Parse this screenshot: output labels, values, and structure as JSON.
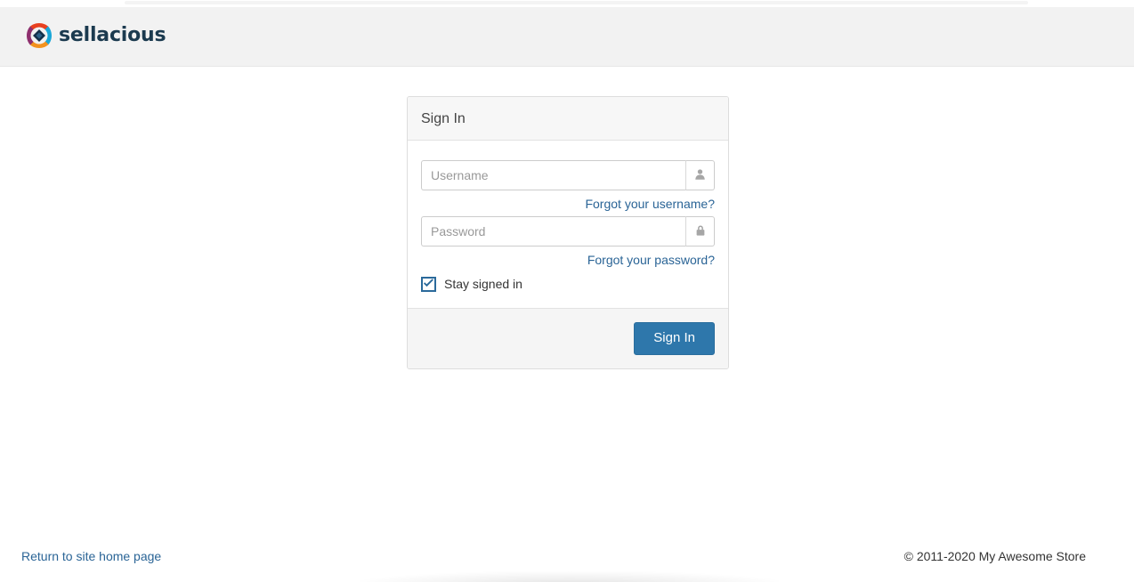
{
  "header": {
    "brand_name": "sellacious",
    "logo_icon": "sellacious-diamond-logo",
    "logo_colors": {
      "top_petal": "#e8401f",
      "right_petal": "#1aa7d8",
      "bottom_petal": "#f3921e",
      "left_petal": "#8e2f6e",
      "center_diamond": "#14304a"
    },
    "background": "#f2f2f2"
  },
  "login": {
    "card_title": "Sign In",
    "username": {
      "placeholder": "Username",
      "value": "",
      "icon": "user-icon",
      "forgot_link": "Forgot your username?"
    },
    "password": {
      "placeholder": "Password",
      "value": "",
      "icon": "lock-icon",
      "forgot_link": "Forgot your password?"
    },
    "remember": {
      "label": "Stay signed in",
      "checked": true
    },
    "submit_label": "Sign In",
    "accent_color": "#2e77ab",
    "link_color": "#2a6496"
  },
  "footer": {
    "home_link": "Return to site home page",
    "copyright": "© 2011-2020 My Awesome Store"
  }
}
